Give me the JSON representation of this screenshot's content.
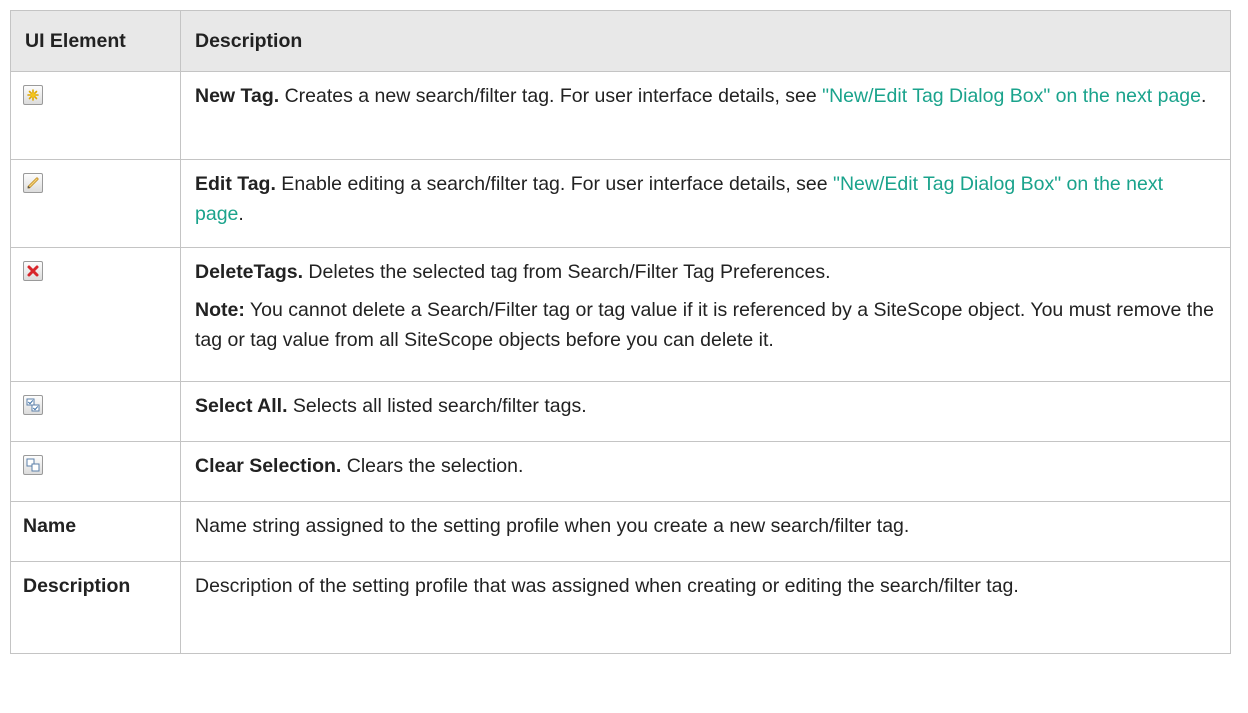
{
  "table": {
    "headers": [
      "UI Element",
      "Description"
    ],
    "rows": [
      {
        "icon": "new-tag-icon",
        "title": "New Tag.",
        "text": " Creates a new search/filter tag. For user interface details, see ",
        "link": "\"New/Edit Tag Dialog Box\" on the next page",
        "after": "."
      },
      {
        "icon": "edit-tag-icon",
        "title": "Edit Tag.",
        "text": " Enable editing a search/filter tag. For user interface details, see ",
        "link": "\"New/Edit Tag Dialog Box\" on the next page",
        "after": "."
      },
      {
        "icon": "delete-tags-icon",
        "title": "DeleteTags.",
        "text": " Deletes the selected tag from Search/Filter Tag Preferences.",
        "note_label": "Note:",
        "note_text": " You cannot delete a Search/Filter tag or tag value if it is referenced by a SiteScope object. You must remove the tag or tag value from all SiteScope objects before you can delete it."
      },
      {
        "icon": "select-all-icon",
        "title": "Select All.",
        "text": " Selects all listed search/filter tags."
      },
      {
        "icon": "clear-selection-icon",
        "title": "Clear Selection.",
        "text": " Clears the selection."
      },
      {
        "label": "Name",
        "text": "Name string assigned to the setting profile when you create a new search/filter tag."
      },
      {
        "label": "Description",
        "text": "Description of the setting profile that was assigned when creating or editing the search/filter tag."
      }
    ]
  },
  "colors": {
    "link": "#1aa38c",
    "header_bg": "#e8e8e8",
    "border": "#c4c4c4",
    "delete_x": "#d8262b",
    "new_star": "#f5c518"
  }
}
